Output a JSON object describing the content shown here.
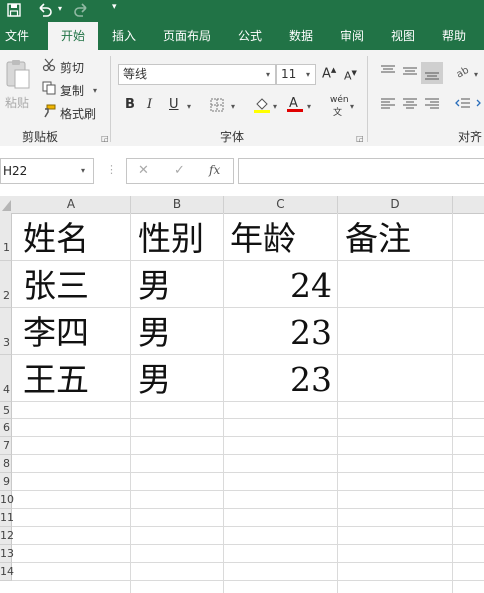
{
  "ribbon_tabs": [
    "文件",
    "开始",
    "插入",
    "页面布局",
    "公式",
    "数据",
    "审阅",
    "视图",
    "帮助"
  ],
  "active_tab": "开始",
  "clipboard": {
    "paste": "粘贴",
    "cut": "剪切",
    "copy": "复制",
    "format_painter": "格式刷",
    "group_label": "剪贴板"
  },
  "font": {
    "name": "等线",
    "size": "11",
    "bold": "B",
    "italic": "I",
    "underline": "U",
    "group_label": "字体",
    "phonetic": "wén"
  },
  "align": {
    "group_label": "对齐"
  },
  "formula_bar": {
    "name_box": "H22",
    "cancel": "✕",
    "enter": "✓",
    "fx": "fx",
    "value": ""
  },
  "columns": [
    "A",
    "B",
    "C",
    "D"
  ],
  "rows": [
    {
      "num": "1",
      "a": "姓名",
      "b": "性别",
      "c": "年龄",
      "d": "备注"
    },
    {
      "num": "2",
      "a": "张三",
      "b": "男",
      "c": "24",
      "d": ""
    },
    {
      "num": "3",
      "a": "李四",
      "b": "男",
      "c": "23",
      "d": ""
    },
    {
      "num": "4",
      "a": "王五",
      "b": "男",
      "c": "23",
      "d": ""
    }
  ],
  "empty_rows": [
    "5",
    "6",
    "7",
    "8",
    "9",
    "10",
    "11",
    "12",
    "13",
    "14"
  ],
  "colors": {
    "excel_green": "#217346",
    "highlight_yellow": "#ffff00",
    "font_red": "#e00000"
  }
}
